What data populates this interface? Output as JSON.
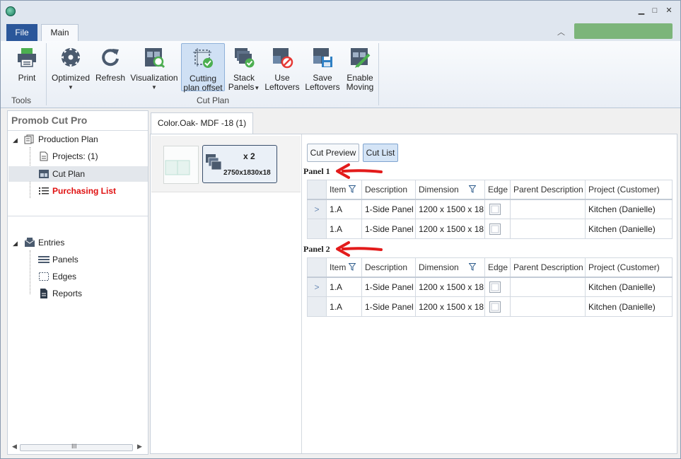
{
  "window": {
    "minimize": "▁",
    "maximize": "□",
    "close": "✕"
  },
  "ribbon": {
    "tabs": {
      "file": "File",
      "main": "Main"
    },
    "collapse": "︿",
    "groups": {
      "tools": "Tools",
      "cut_plan": "Cut Plan"
    },
    "buttons": {
      "print": "Print",
      "optimized": "Optimized",
      "refresh": "Refresh",
      "visualization": "Visualization",
      "cutting_l1": "Cutting",
      "cutting_l2": "plan offset",
      "stack_l1": "Stack",
      "stack_l2": "Panels",
      "use_l1": "Use",
      "use_l2": "Leftovers",
      "save_l1": "Save",
      "save_l2": "Leftovers",
      "enable_l1": "Enable",
      "enable_l2": "Moving"
    }
  },
  "sidebar": {
    "title": "Promob Cut Pro",
    "production_plan": "Production Plan",
    "projects": "Projects: (1)",
    "cut_plan": "Cut Plan",
    "purchasing_list": "Purchasing List",
    "entries": "Entries",
    "panels": "Panels",
    "edges": "Edges",
    "reports": "Reports",
    "scroll_grip": "III"
  },
  "document_tab": "Color.Oak- MDF -18 (1)",
  "sheet": {
    "count": "x 2",
    "size": "2750x1830x18"
  },
  "view_buttons": {
    "cut_preview": "Cut Preview",
    "cut_list": "Cut List"
  },
  "columns": [
    "Item",
    "Description",
    "Dimension",
    "Edge",
    "Parent Description",
    "Project (Customer)"
  ],
  "panels": [
    {
      "label": "Panel 1",
      "rows": [
        {
          "item": "1.A",
          "description": "1-Side Panel",
          "dimension": "1200 x 1500 x 18",
          "parent": "",
          "project": "Kitchen (Danielle)"
        },
        {
          "item": "1.A",
          "description": "1-Side Panel",
          "dimension": "1200 x 1500 x 18",
          "parent": "",
          "project": "Kitchen (Danielle)"
        }
      ]
    },
    {
      "label": "Panel 2",
      "rows": [
        {
          "item": "1.A",
          "description": "1-Side Panel",
          "dimension": "1200 x 1500 x 18",
          "parent": "",
          "project": "Kitchen (Danielle)"
        },
        {
          "item": "1.A",
          "description": "1-Side Panel",
          "dimension": "1200 x 1500 x 18",
          "parent": "",
          "project": "Kitchen (Danielle)"
        }
      ]
    }
  ],
  "row_selector": ">",
  "colors": {
    "file_tab": "#2b579a",
    "accent_green": "#7cb57a",
    "purchasing": "#e01010",
    "arrow": "#e31b1b"
  }
}
